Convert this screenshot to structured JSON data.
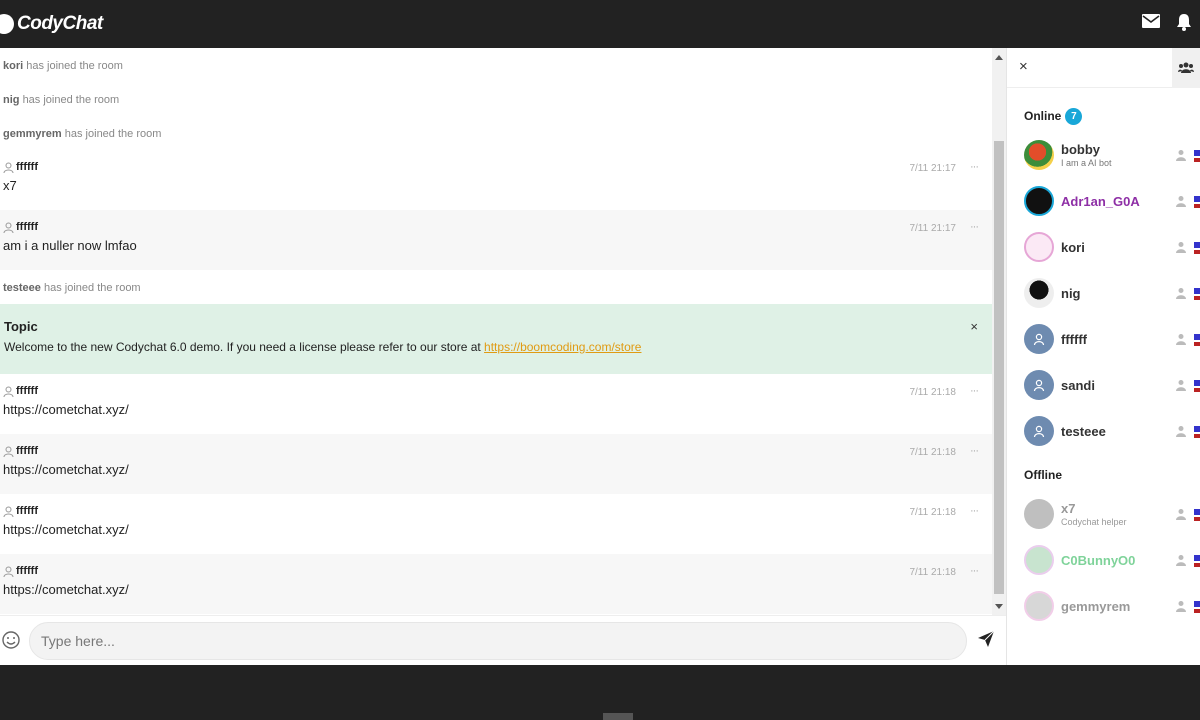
{
  "app": {
    "logo_text": "CodyChat"
  },
  "header": {
    "icons": [
      "envelope-icon",
      "bell-icon"
    ]
  },
  "messages": [
    {
      "type": "system",
      "user": "kori",
      "text": "has joined the room"
    },
    {
      "type": "system",
      "user": "nig",
      "text": "has joined the room"
    },
    {
      "type": "system",
      "user": "gemmyrem",
      "text": "has joined the room"
    },
    {
      "type": "chat",
      "user": "ffffff",
      "text": "x7",
      "time": "7/11 21:17"
    },
    {
      "type": "chat",
      "user": "ffffff",
      "text": "am i a nuller now lmfao",
      "time": "7/11 21:17"
    },
    {
      "type": "system",
      "user": "testeee",
      "text": "has joined the room"
    },
    {
      "type": "chat",
      "user": "ffffff",
      "text": "https://cometchat.xyz/",
      "time": "7/11 21:18"
    },
    {
      "type": "chat",
      "user": "ffffff",
      "text": "https://cometchat.xyz/",
      "time": "7/11 21:18"
    },
    {
      "type": "chat",
      "user": "ffffff",
      "text": "https://cometchat.xyz/",
      "time": "7/11 21:18"
    },
    {
      "type": "chat",
      "user": "ffffff",
      "text": "https://cometchat.xyz/",
      "time": "7/11 21:18"
    }
  ],
  "more_glyph": "···",
  "topic": {
    "title": "Topic",
    "text": "Welcome to the new Codychat 6.0 demo. If you need a license please refer to our store at ",
    "link": "https://boomcoding.com/store",
    "close": "×"
  },
  "composer": {
    "placeholder": "Type here..."
  },
  "sidebar": {
    "close": "×",
    "online_label": "Online",
    "online_count": "7",
    "offline_label": "Offline",
    "online_users": [
      {
        "name": "bobby",
        "mood": "I am a AI bot",
        "name_color": "#333333"
      },
      {
        "name": "Adr1an_G0A",
        "mood": "",
        "name_color": "#8e2fa6"
      },
      {
        "name": "kori",
        "mood": "",
        "name_color": "#333333"
      },
      {
        "name": "nig",
        "mood": "",
        "name_color": "#333333"
      },
      {
        "name": "ffffff",
        "mood": "",
        "name_color": "#333333"
      },
      {
        "name": "sandi",
        "mood": "",
        "name_color": "#333333"
      },
      {
        "name": "testeee",
        "mood": "",
        "name_color": "#333333"
      }
    ],
    "offline_users": [
      {
        "name": "x7",
        "mood": "Codychat helper",
        "name_color": "#999999"
      },
      {
        "name": "C0BunnyO0",
        "mood": "",
        "name_color": "#7fd39a"
      },
      {
        "name": "gemmyrem",
        "mood": "",
        "name_color": "#999999"
      }
    ]
  },
  "colors": {
    "accent": "#19a7d8",
    "topic_bg": "#dff1e6",
    "link": "#e09b13",
    "header_bg": "#222222"
  }
}
